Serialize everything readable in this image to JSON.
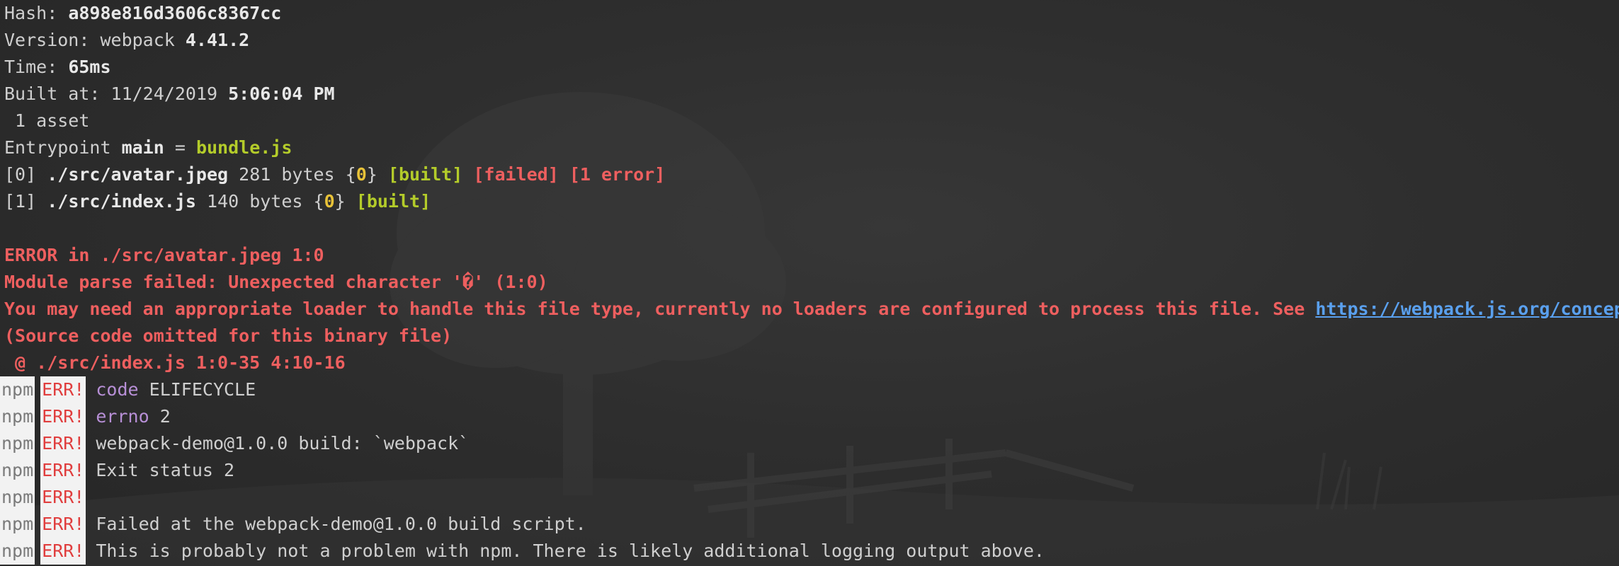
{
  "build": {
    "hash_label": "Hash: ",
    "hash_value": "a898e816d3606c8367cc",
    "version_label": "Version: webpack ",
    "version_value": "4.41.2",
    "time_label": "Time: ",
    "time_value": "65ms",
    "built_label": "Built at: 11/24/2019 ",
    "built_time": "5:06:04 PM",
    "assets": " 1 asset",
    "entry_label": "Entrypoint ",
    "entry_name": "main",
    "entry_eq": " = ",
    "entry_file": "bundle.js"
  },
  "modules": [
    {
      "index": "[0]",
      "path": "./src/avatar.jpeg",
      "size": " 281 bytes ",
      "chunk_open": "{",
      "chunk": "0",
      "chunk_close": "}",
      "built": "[built]",
      "failed": "[failed]",
      "errors": "[1 error]"
    },
    {
      "index": "[1]",
      "path": "./src/index.js",
      "size": " 140 bytes ",
      "chunk_open": "{",
      "chunk": "0",
      "chunk_close": "}",
      "built": "[built]"
    }
  ],
  "error": {
    "heading": "ERROR in ./src/avatar.jpeg 1:0",
    "parse": "Module parse failed: Unexpected character '�' (1:0)",
    "loader_msg": "You may need an appropriate loader to handle this file type, currently no loaders are configured to process this file. See ",
    "loader_link": "https://webpack.js.org/concepts#loaders",
    "source_omitted": "(Source code omitted for this binary file)",
    "at_line": " @ ./src/index.js 1:0-35 4:10-16"
  },
  "npm": {
    "npm_tag": "npm",
    "err_tag": "ERR!",
    "lines": [
      {
        "key": "code",
        "value": " ELIFECYCLE"
      },
      {
        "key": "errno",
        "value": " 2"
      },
      {
        "key": "",
        "value": "webpack-demo@1.0.0 build: `webpack`"
      },
      {
        "key": "",
        "value": "Exit status 2"
      },
      {
        "key": "",
        "value": ""
      },
      {
        "key": "",
        "value": "Failed at the webpack-demo@1.0.0 build script."
      },
      {
        "key": "",
        "value": "This is probably not a problem with npm. There is likely additional logging output above."
      }
    ]
  },
  "colors": {
    "background": "#2b2b2b",
    "text": "#cfcfcf",
    "green": "#b4cc2a",
    "yellow": "#e8c238",
    "red": "#ee5f5f",
    "purple": "#b78fd6",
    "link": "#5aa0ee"
  }
}
